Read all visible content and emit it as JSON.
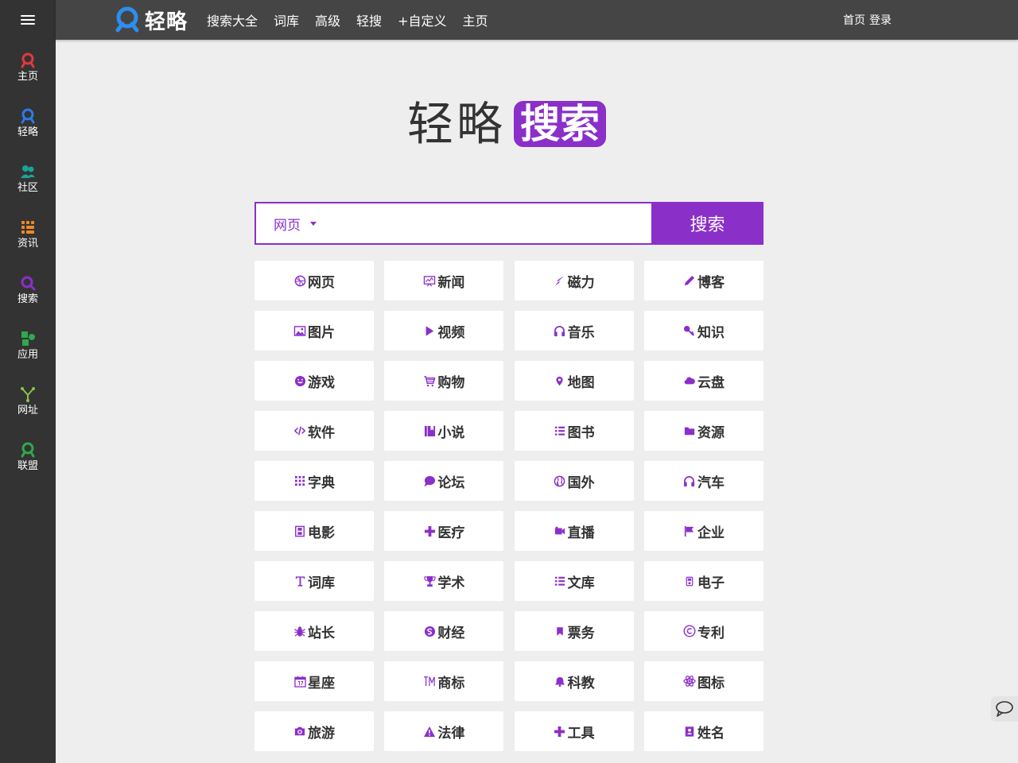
{
  "colors": {
    "accent": "#8b2fc9",
    "sidebar_bg": "#333333",
    "topbar_bg": "#454545",
    "page_bg": "#eeeeee"
  },
  "sidebar": {
    "menu_icon": "menu-icon",
    "items": [
      {
        "label": "主页",
        "icon": "home-icon",
        "color": "#e0393e"
      },
      {
        "label": "轻略",
        "icon": "qinglue-icon",
        "color": "#2c7be5"
      },
      {
        "label": "社区",
        "icon": "community-icon",
        "color": "#1aa39a"
      },
      {
        "label": "资讯",
        "icon": "news-icon",
        "color": "#f08a24"
      },
      {
        "label": "搜索",
        "icon": "search-icon",
        "color": "#8b2fc9"
      },
      {
        "label": "应用",
        "icon": "apps-icon",
        "color": "#2fa84f"
      },
      {
        "label": "网址",
        "icon": "links-icon",
        "color": "#8bc34a"
      },
      {
        "label": "联盟",
        "icon": "alliance-icon",
        "color": "#2fa84f"
      }
    ]
  },
  "topbar": {
    "logo_text": "轻略",
    "nav": [
      "搜索大全",
      "词库",
      "高级",
      "轻搜",
      "+自定义",
      "主页"
    ],
    "home_link": "首页",
    "login_link": "登录"
  },
  "brand": {
    "left": "轻略",
    "right": "搜索"
  },
  "search": {
    "type": "网页",
    "placeholder": "",
    "button": "搜索"
  },
  "categories": [
    {
      "label": "网页",
      "icon": "dribbble-icon"
    },
    {
      "label": "新闻",
      "icon": "dashboard-icon"
    },
    {
      "label": "磁力",
      "icon": "bolt-icon"
    },
    {
      "label": "博客",
      "icon": "pencil-icon"
    },
    {
      "label": "图片",
      "icon": "image-icon"
    },
    {
      "label": "视频",
      "icon": "play-icon"
    },
    {
      "label": "音乐",
      "icon": "headphones-icon"
    },
    {
      "label": "知识",
      "icon": "key-icon"
    },
    {
      "label": "游戏",
      "icon": "smile-icon"
    },
    {
      "label": "购物",
      "icon": "cart-icon"
    },
    {
      "label": "地图",
      "icon": "map-marker-icon"
    },
    {
      "label": "云盘",
      "icon": "cloud-icon"
    },
    {
      "label": "软件",
      "icon": "code-icon"
    },
    {
      "label": "小说",
      "icon": "book-icon"
    },
    {
      "label": "图书",
      "icon": "list-icon"
    },
    {
      "label": "资源",
      "icon": "folder-icon"
    },
    {
      "label": "字典",
      "icon": "grid-icon"
    },
    {
      "label": "论坛",
      "icon": "comment-icon"
    },
    {
      "label": "国外",
      "icon": "globe-icon"
    },
    {
      "label": "汽车",
      "icon": "headphones-icon"
    },
    {
      "label": "电影",
      "icon": "film-icon"
    },
    {
      "label": "医疗",
      "icon": "plus-icon"
    },
    {
      "label": "直播",
      "icon": "video-camera-icon"
    },
    {
      "label": "企业",
      "icon": "flag-icon"
    },
    {
      "label": "词库",
      "icon": "text-icon"
    },
    {
      "label": "学术",
      "icon": "trophy-icon"
    },
    {
      "label": "文库",
      "icon": "list-icon"
    },
    {
      "label": "电子",
      "icon": "ipod-icon"
    },
    {
      "label": "站长",
      "icon": "bug-icon"
    },
    {
      "label": "财经",
      "icon": "skype-icon"
    },
    {
      "label": "票务",
      "icon": "bookmark-icon"
    },
    {
      "label": "专利",
      "icon": "copyright-icon"
    },
    {
      "label": "星座",
      "icon": "calendar-icon"
    },
    {
      "label": "商标",
      "icon": "trademark-icon"
    },
    {
      "label": "科教",
      "icon": "bell-icon"
    },
    {
      "label": "图标",
      "icon": "atom-icon"
    },
    {
      "label": "旅游",
      "icon": "camera-icon"
    },
    {
      "label": "法律",
      "icon": "warning-icon"
    },
    {
      "label": "工具",
      "icon": "plus-icon"
    },
    {
      "label": "姓名",
      "icon": "contact-book-icon"
    }
  ],
  "chat_icon": "chat-bubble-icon"
}
